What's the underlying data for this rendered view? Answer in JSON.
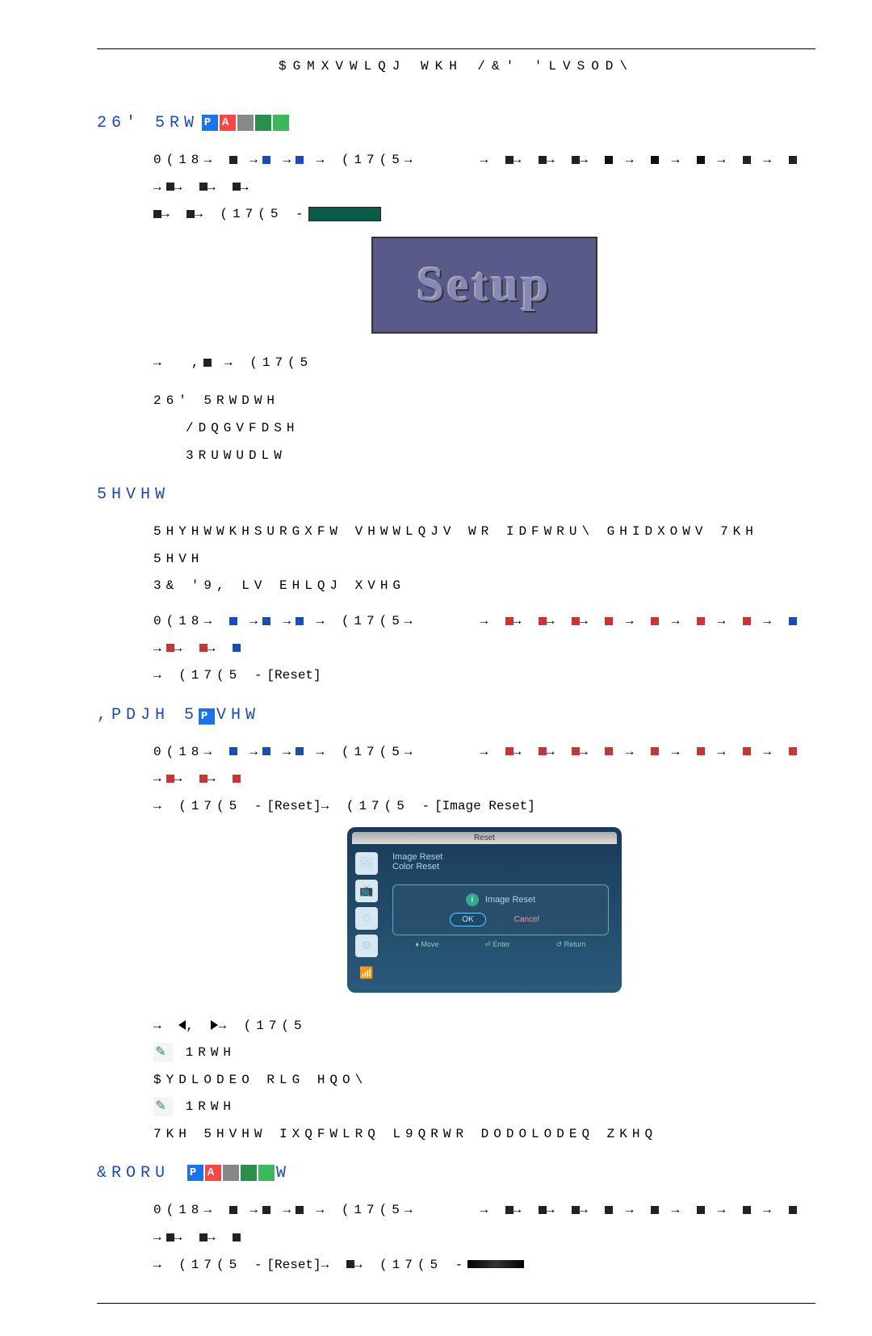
{
  "header": "$GMXVWLQJ WKH /&' 'LVSOD\\",
  "sec1": {
    "title": "26' 5RW",
    "line1a": "0(18",
    "line1b": "(17(5",
    "line2": "(17(5",
    "setup_word": "Setup",
    "line3a": ",",
    "line3b": "(17(5",
    "sub1": "26' 5RWDWH",
    "sub2": "/DQGVFDSH",
    "sub3": "3RUWUDLW"
  },
  "sec2": {
    "title": "5HVHW",
    "para_a": "5HYHWWKHSURGXFW VHWWLQJV WR IDFWRU\\ GHIDXOWV 7KH 5HVH",
    "para_b": "3& '9, LV EHLQJ XVHG",
    "line1a": "0(18",
    "line1b": "(17(5",
    "line2": "(17(5",
    "reset_label": "[Reset]"
  },
  "sec3": {
    "title_a": ",PDJH 5",
    "title_b": "VHW",
    "line1a": "0(18",
    "line1b": "(17(5",
    "line2a": "(17(5",
    "reset_label": "[Reset]",
    "line2b": "(17(5",
    "image_reset_label": "[Image Reset]",
    "panel": {
      "header": "Reset",
      "item1": "Image Reset",
      "item2": "Color Reset",
      "popup_title": "Image Reset",
      "ok": "OK",
      "cancel": "Cancel",
      "foot_move": "Move",
      "foot_enter": "Enter",
      "foot_return": "Return"
    },
    "line3": "(17(5",
    "note_label": "1RWH",
    "avail": "$YDLODEO RLG HQO\\",
    "note2": "1RWH",
    "resetfn": "7KH 5HVHW IXQFWLRQ L9QRWR DODOLODEQ ZKHQ"
  },
  "sec4": {
    "title_a": "&RORU ",
    "title_b": "W",
    "line1a": "0(18",
    "line1b": "(17(5",
    "line2a": "(17(5",
    "reset_label": "[Reset]",
    "line2b": "(17(5"
  }
}
